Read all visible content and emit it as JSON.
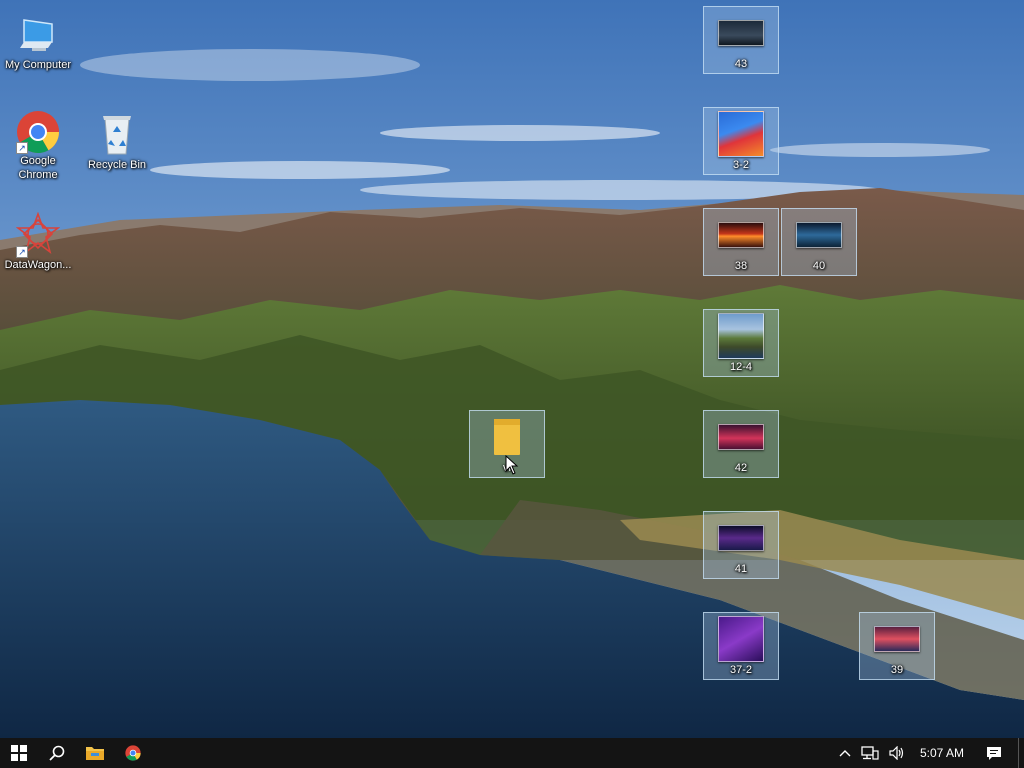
{
  "desktop": {
    "icons": [
      {
        "id": "my-computer",
        "label": "My Computer"
      },
      {
        "id": "google-chrome",
        "label": "Google Chrome"
      },
      {
        "id": "recycle-bin",
        "label": "Recycle Bin"
      },
      {
        "id": "datawagon",
        "label": "DataWagon..."
      },
      {
        "id": "file-43",
        "label": "43"
      },
      {
        "id": "file-3-2",
        "label": "3-2"
      },
      {
        "id": "file-38",
        "label": "38"
      },
      {
        "id": "file-40",
        "label": "40"
      },
      {
        "id": "file-12-4",
        "label": "12-4"
      },
      {
        "id": "file-42",
        "label": "42"
      },
      {
        "id": "file-41",
        "label": "41"
      },
      {
        "id": "file-37-2",
        "label": "37-2"
      },
      {
        "id": "file-39",
        "label": "39"
      },
      {
        "id": "folder-vi",
        "label": "vi"
      }
    ]
  },
  "taskbar": {
    "pinned": [
      "start-button",
      "search-button",
      "file-explorer-button",
      "chrome-button"
    ],
    "clock": "5:07 AM"
  },
  "colors": {
    "taskbar": "#141414",
    "selection": "#aac8e6"
  }
}
